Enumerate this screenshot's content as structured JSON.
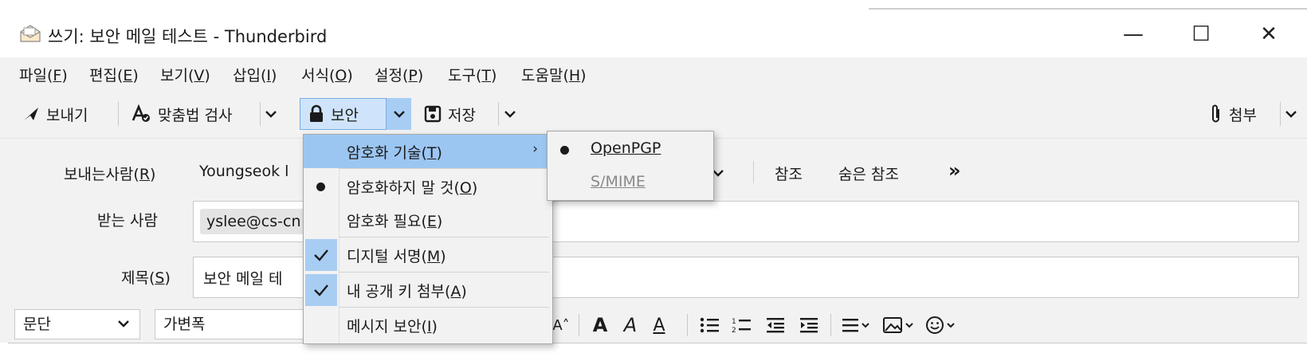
{
  "window": {
    "title": "쓰기: 보안 메일 테스트 - Thunderbird",
    "controls": {
      "minimize": "—",
      "maximize": "☐",
      "close": "✕"
    }
  },
  "menubar": [
    {
      "label": "파일",
      "accel": "F"
    },
    {
      "label": "편집",
      "accel": "E"
    },
    {
      "label": "보기",
      "accel": "V"
    },
    {
      "label": "삽입",
      "accel": "I"
    },
    {
      "label": "서식",
      "accel": "O"
    },
    {
      "label": "설정",
      "accel": "P"
    },
    {
      "label": "도구",
      "accel": "T"
    },
    {
      "label": "도움말",
      "accel": "H"
    }
  ],
  "toolbar": {
    "send": "보내기",
    "spell": "맞춤법 검사",
    "security": "보안",
    "save": "저장",
    "attach": "첨부"
  },
  "header": {
    "from_label": "보내는사람",
    "from_accel": "R",
    "from_value": "Youngseok l",
    "cc": "참조",
    "bcc": "숨은 참조",
    "more": "»",
    "to_label": "받는 사람",
    "to_value": "yslee@cs-cn",
    "subject_label": "제목",
    "subject_accel": "S",
    "subject_value": "보안 메일 테"
  },
  "format": {
    "paragraph": "문단",
    "font": "가변폭"
  },
  "security_menu": [
    {
      "label": "암호화 기술",
      "accel": "T",
      "submenu": true,
      "highlighted": true
    },
    {
      "label": "암호화하지 말 것",
      "accel": "O",
      "state": "radio-selected"
    },
    {
      "label": "암호화 필요",
      "accel": "E",
      "state": "none"
    },
    {
      "label": "디지털 서명",
      "accel": "M",
      "state": "checked"
    },
    {
      "label": "내 공개 키 첨부",
      "accel": "A",
      "state": "checked"
    },
    {
      "label": "메시지 보안",
      "accel": "I",
      "state": "none"
    }
  ],
  "encryption_tech_menu": [
    {
      "label": "OpenPGP",
      "accel": "O",
      "selected": true,
      "enabled": true
    },
    {
      "label": "S/MIME",
      "accel": "S",
      "selected": false,
      "enabled": false
    }
  ],
  "colors": {
    "highlight": "#9cc6f2",
    "check_bg": "#a8cdf3",
    "toolbar_bg": "#f2f2f2"
  }
}
